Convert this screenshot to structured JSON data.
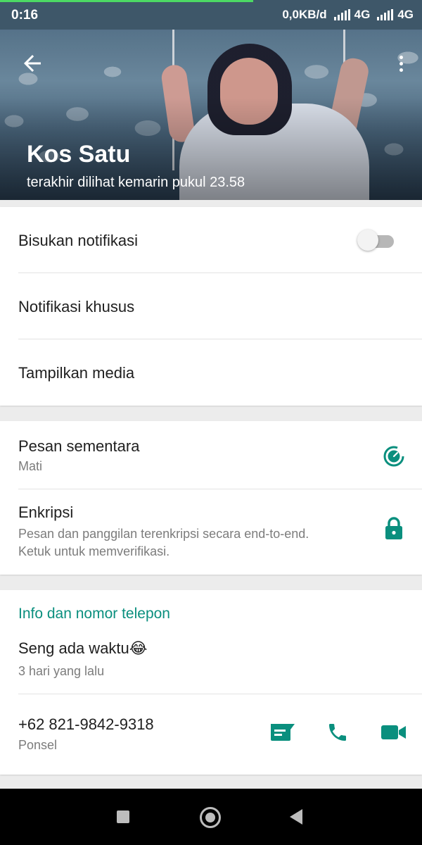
{
  "status_bar": {
    "time": "0:16",
    "network_speed": "0,0KB/d",
    "network_1": "4G",
    "network_2": "4G"
  },
  "header": {
    "contact_name": "Kos Satu",
    "last_seen": "terakhir dilihat kemarin pukul 23.58"
  },
  "notifications": {
    "mute_label": "Bisukan notifikasi",
    "mute_enabled": false,
    "custom_label": "Notifikasi khusus",
    "media_label": "Tampilkan media"
  },
  "security": {
    "disappearing_label": "Pesan sementara",
    "disappearing_value": "Mati",
    "encryption_label": "Enkripsi",
    "encryption_line1": "Pesan dan panggilan terenkripsi secara end-to-end.",
    "encryption_line2": "Ketuk untuk memverifikasi."
  },
  "info": {
    "section_title": "Info dan nomor telepon",
    "about_text": "Seng ada waktu😂",
    "about_date": "3 hari yang lalu",
    "phone_number": "+62 821-9842-9318",
    "phone_type": "Ponsel"
  },
  "colors": {
    "accent": "#0a8f7e",
    "status_bar": "#3e5769"
  },
  "icons": {
    "back": "arrow-left-icon",
    "menu": "more-vertical-icon",
    "timer": "timer-icon",
    "lock": "lock-icon",
    "message": "message-icon",
    "phone": "phone-icon",
    "video": "video-icon"
  }
}
